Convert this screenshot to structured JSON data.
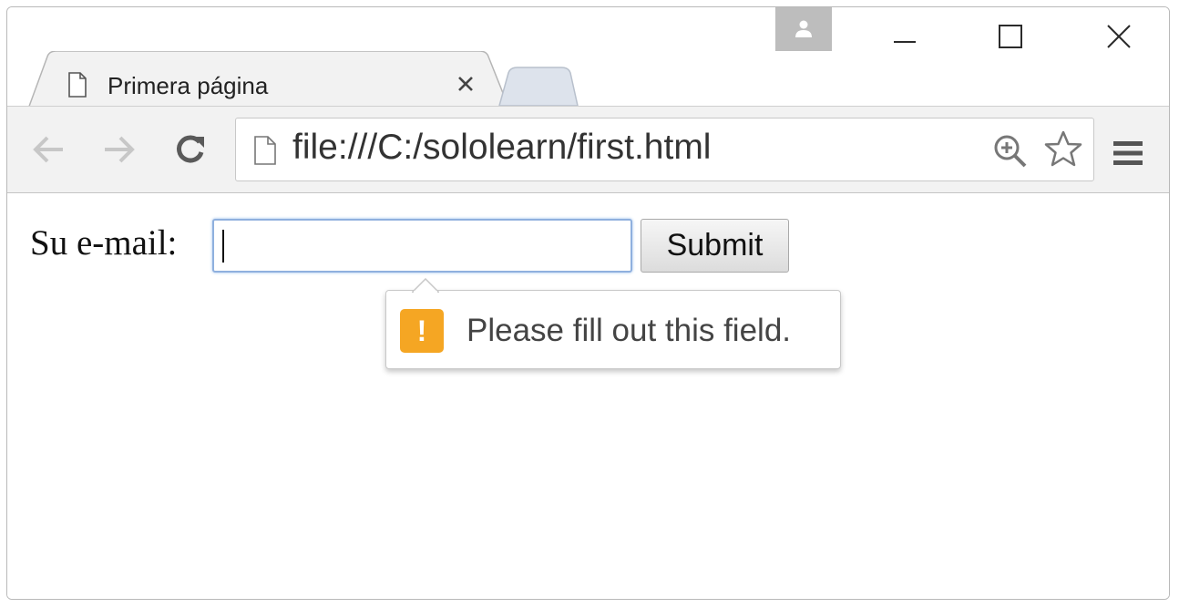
{
  "browser": {
    "tab": {
      "title": "Primera página"
    },
    "omnibox": {
      "url": "file:///C:/sololearn/first.html"
    },
    "accent_colors": {
      "focus_ring": "#8fb0de",
      "warning": "#f5a623"
    },
    "icons": [
      "page-icon",
      "close-icon",
      "back-arrow-icon",
      "forward-arrow-icon",
      "reload-icon",
      "zoom-icon",
      "star-icon",
      "menu-icon",
      "profile-icon",
      "minimize-icon",
      "maximize-icon",
      "warning-icon"
    ]
  },
  "page": {
    "form": {
      "label": "Su e-mail:",
      "input_value": "",
      "submit_label": "Submit"
    },
    "validation": {
      "icon_glyph": "!",
      "message": "Please fill out this field."
    }
  }
}
